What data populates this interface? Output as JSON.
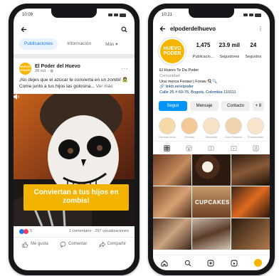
{
  "facebook": {
    "status_time": "10:09",
    "tabs": [
      "Publicaciones",
      "Información",
      "Más"
    ],
    "more_chevron": "▾",
    "page_name": "El Poder del Huevo",
    "avatar_text": "HUEVO PODER",
    "post_meta": "28 oct. · ",
    "post_text": "¡No dejes que el azúcar te convierta en un zombi! 🧟 Come junto a tus hijos las golosina...",
    "see_more": "Ver más",
    "image_caption": "Conviertan a tus hijos en zombis!",
    "reaction_count": "5",
    "stats_text": "1 comentario · 297 visualizaciones",
    "actions": [
      "Me gusta",
      "Comentar",
      "Compartir"
    ],
    "colors": {
      "accent": "#1877f2",
      "brand": "#f2b400"
    }
  },
  "instagram": {
    "status_time": "10:21",
    "username": "elpoderdelhuevo",
    "avatar_text": "HUEVO PODER",
    "stats": [
      {
        "value": "1,475",
        "label": "Publicacio..."
      },
      {
        "value": "23.9 mil",
        "label": "Seguidores"
      },
      {
        "value": "24",
        "label": "Seguidos"
      }
    ],
    "bio": {
      "name": "El Huevo Te Da Poder",
      "category": "Comunidad",
      "line1": "Una merca Fenavi | Fonav 🍳🔍",
      "link": "🔗 linktr.ee/elpoder",
      "address": "Calle 26 # 69-76, Bogotá, Colombia 110111"
    },
    "buttons": [
      "Seguir",
      "Mensaje",
      "Contacto",
      "+ 8"
    ],
    "highlights": [
      "Recetas Inicio",
      "Recetas",
      "Reportaje",
      "Ciclo Expansión",
      "Promociones"
    ],
    "grid_labels": [
      "CUPCAKES"
    ],
    "colors": {
      "accent": "#0095f6",
      "brand": "#f7b500"
    }
  }
}
